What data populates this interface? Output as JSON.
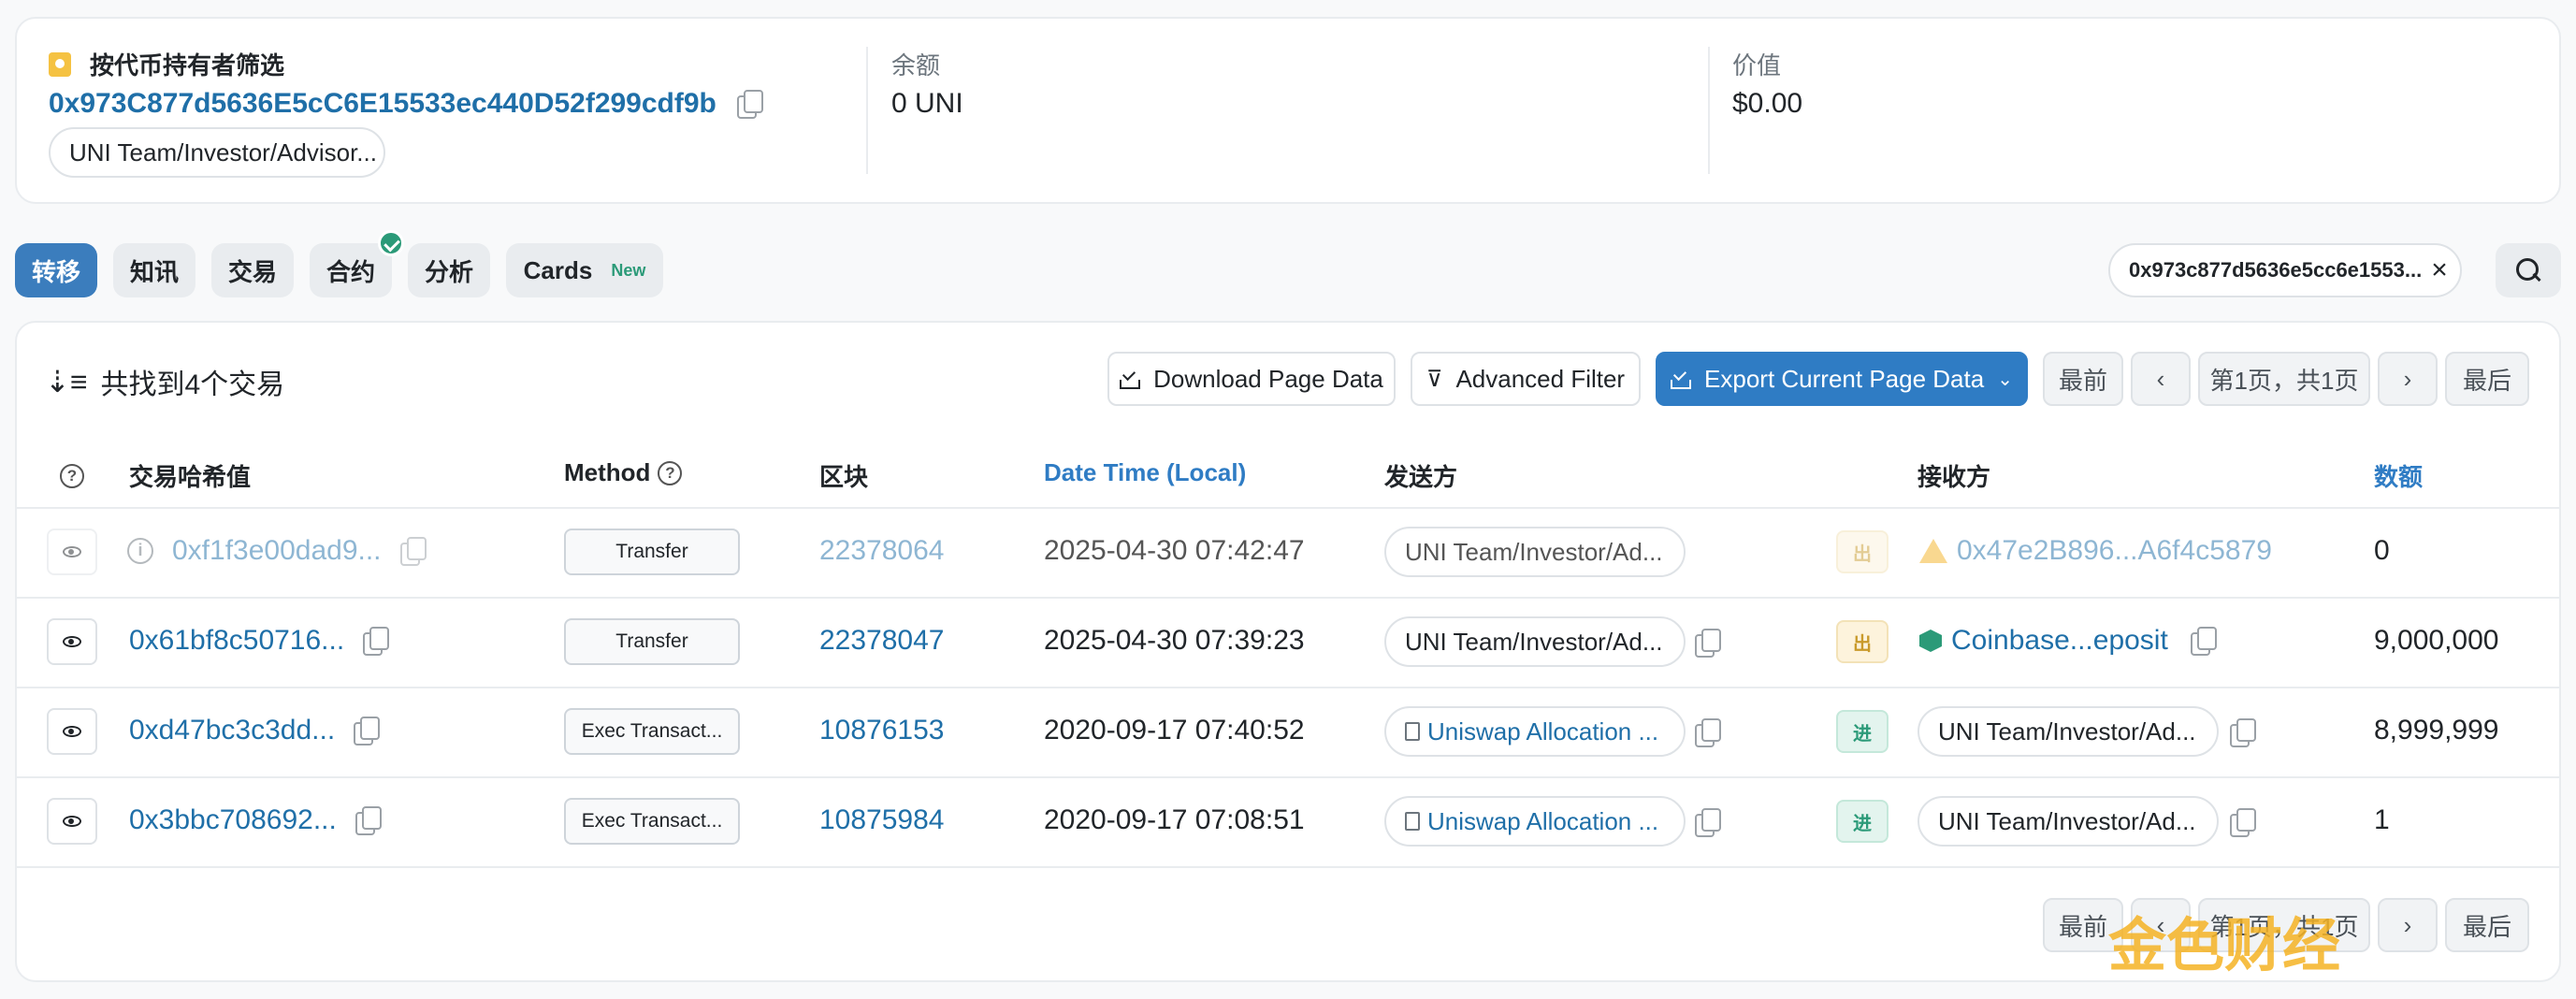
{
  "header": {
    "label_title": "按代币持有者筛选",
    "address": "0x973C877d5636E5cC6E15533ec440D52f299cdf9b",
    "tag": "UNI Team/Investor/Advisor...",
    "balance_label": "余额",
    "balance_value": "0 UNI",
    "value_label": "价值",
    "value_value": "$0.00"
  },
  "tabs": [
    {
      "label": "转移",
      "active": true
    },
    {
      "label": "知讯"
    },
    {
      "label": "交易"
    },
    {
      "label": "合约"
    },
    {
      "label": "分析"
    },
    {
      "label": "Cards",
      "badge": "New"
    }
  ],
  "filter": {
    "address": "0x973c877d5636e5cc6e1553..."
  },
  "toolbar": {
    "found_text": "共找到4个交易",
    "download_label": "Download Page Data",
    "advanced_filter_label": "Advanced Filter",
    "export_label": "Export Current Page Data"
  },
  "pagination": {
    "first": "最前",
    "page_info": "第1页，共1页",
    "last": "最后"
  },
  "table": {
    "headers": {
      "hash": "交易哈希值",
      "method": "Method",
      "block": "区块",
      "datetime": "Date Time (Local)",
      "from": "发送方",
      "to": "接收方",
      "amount": "数额"
    },
    "rows": [
      {
        "hash": "0xf1f3e00dad9...",
        "method": "Transfer",
        "block": "22378064",
        "time": "2025-04-30 07:42:47",
        "from": "UNI Team/Investor/Ad...",
        "dir": "出",
        "to": "0x47e2B896...A6f4c5879",
        "amount": "0"
      },
      {
        "hash": "0x61bf8c50716...",
        "method": "Transfer",
        "block": "22378047",
        "time": "2025-04-30 07:39:23",
        "from": "UNI Team/Investor/Ad...",
        "dir": "出",
        "to": "Coinbase...eposit",
        "amount": "9,000,000"
      },
      {
        "hash": "0xd47bc3c3dd...",
        "method": "Exec Transact...",
        "block": "10876153",
        "time": "2020-09-17 07:40:52",
        "from": "Uniswap Allocation ...",
        "dir": "进",
        "to": "UNI Team/Investor/Ad...",
        "amount": "8,999,999"
      },
      {
        "hash": "0x3bbc708692...",
        "method": "Exec Transact...",
        "block": "10875984",
        "time": "2020-09-17 07:08:51",
        "from": "Uniswap Allocation ...",
        "dir": "进",
        "to": "UNI Team/Investor/Ad...",
        "amount": "1"
      }
    ]
  },
  "watermark": "金色财经"
}
